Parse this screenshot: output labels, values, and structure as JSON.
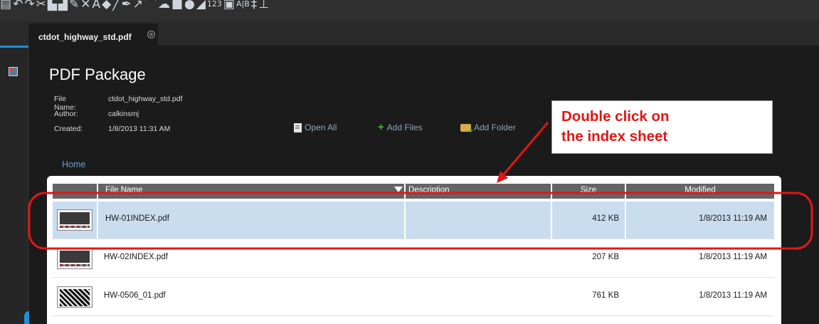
{
  "tab": {
    "title": "ctdot_highway_std.pdf",
    "close_glyph": "⊗"
  },
  "toolbar": {
    "icons": [
      "ocr-icon",
      "undo-icon",
      "redo-icon",
      "scissors-icon",
      "copy-icon",
      "paste-icon",
      "highlight-icon",
      "strikeout-icon",
      "text-icon",
      "stamp-icon",
      "line-icon",
      "pen-icon",
      "arrow-icon",
      "polyline-icon",
      "cloud-icon",
      "shapes-icon",
      "fill-icon",
      "measure-icon",
      "count-icon",
      "text-edit-icon",
      "spell-icon",
      "insert-text-icon",
      "underline-icon"
    ],
    "small_labels": [
      "123",
      "A|B"
    ]
  },
  "package": {
    "title": "PDF Package",
    "file_name_label": "File Name:",
    "file_name": "ctdot_highway_std.pdf",
    "author_label": "Author:",
    "author": "calkinsmj",
    "created_label": "Created:",
    "created": "1/8/2013 11:31 AM"
  },
  "actions": {
    "open_all": "Open All",
    "add_files": "Add Files",
    "add_folder": "Add Folder"
  },
  "breadcrumb": {
    "home": "Home"
  },
  "table": {
    "headers": {
      "file_name": "File Name",
      "description": "Description",
      "size": "Size",
      "modified": "Modified"
    },
    "rows": [
      {
        "name": "HW-01INDEX.pdf",
        "description": "",
        "size": "412 KB",
        "modified": "1/8/2013 11:19 AM",
        "selected": true
      },
      {
        "name": "HW-02INDEX.pdf",
        "description": "",
        "size": "207 KB",
        "modified": "1/8/2013 11:19 AM",
        "selected": false
      },
      {
        "name": "HW-0506_01.pdf",
        "description": "",
        "size": "761 KB",
        "modified": "1/8/2013 11:19 AM",
        "selected": false
      }
    ]
  },
  "annotation": {
    "text": "Double click on\nthe index sheet",
    "color": "#e41515"
  },
  "colors": {
    "selected_row": "#c9ddef",
    "header_bg": "#646464",
    "link": "#6a9bd1",
    "rail_accent": "#1e90d6"
  }
}
